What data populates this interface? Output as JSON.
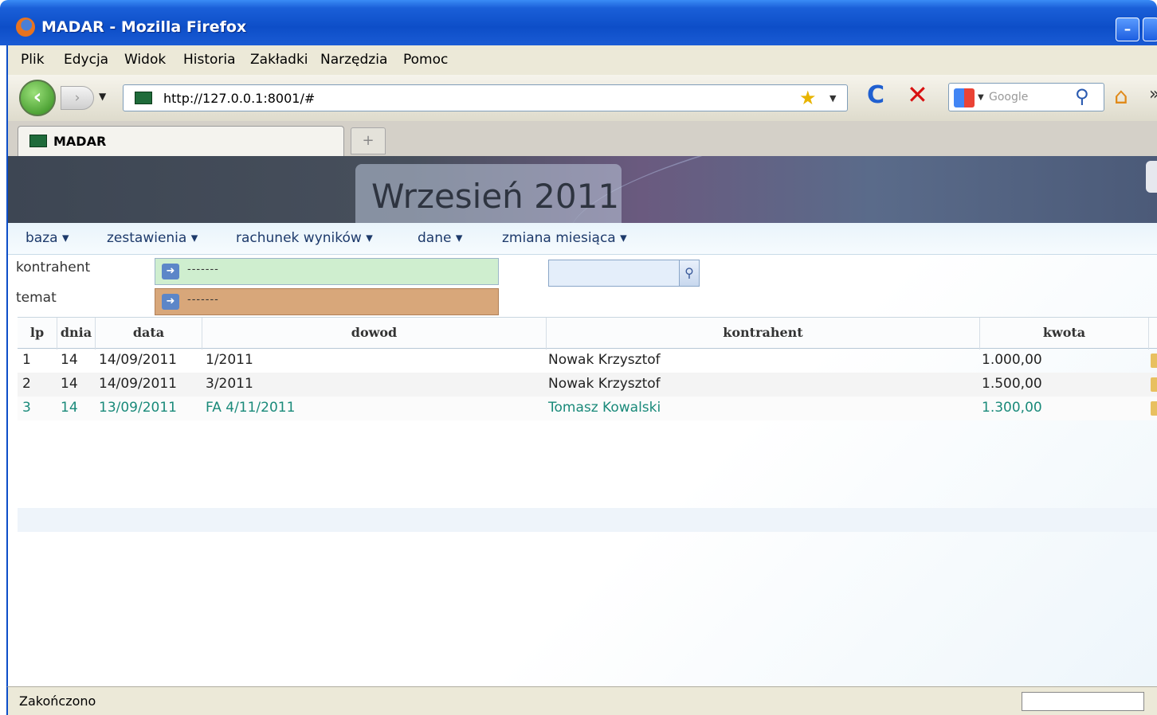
{
  "window": {
    "title": "MADAR - Mozilla Firefox"
  },
  "menubar": {
    "items": [
      "Plik",
      "Edycja",
      "Widok",
      "Historia",
      "Zakładki",
      "Narzędzia",
      "Pomoc"
    ]
  },
  "navbar": {
    "url": "http://127.0.0.1:8001/#",
    "search_placeholder": "Google"
  },
  "tab": {
    "label": "MADAR",
    "new_tab": "+"
  },
  "app": {
    "month_title": "Wrzesień 2011",
    "menu": [
      "baza ▾",
      "zestawienia ▾",
      "rachunek wyników ▾",
      "dane ▾",
      "zmiana miesiąca ▾"
    ],
    "filters": {
      "kontrahent_label": "kontrahent",
      "temat_label": "temat",
      "kontrahent_value": "-------",
      "temat_value": "-------",
      "search_value": ""
    },
    "grid": {
      "headers": [
        "lp",
        "dnia",
        "data",
        "dowod",
        "kontrahent",
        "kwota"
      ],
      "rows": [
        {
          "lp": "1",
          "dnia": "14",
          "data": "14/09/2011",
          "dowod": "1/2011",
          "kontrahent": "Nowak Krzysztof",
          "kwota": "1.000,00"
        },
        {
          "lp": "2",
          "dnia": "14",
          "data": "14/09/2011",
          "dowod": "3/2011",
          "kontrahent": "Nowak Krzysztof",
          "kwota": "1.500,00"
        },
        {
          "lp": "3",
          "dnia": "14",
          "data": "13/09/2011",
          "dowod": "FA 4/11/2011",
          "kontrahent": "Tomasz Kowalski",
          "kwota": "1.300,00"
        }
      ]
    }
  },
  "statusbar": {
    "text": "Zakończono"
  },
  "colors": {
    "titlebar": "#0d4ec8",
    "selected_row_text": "#1a8a7a",
    "kontrahent_combo": "#cfeecf",
    "temat_combo": "#d8a77a"
  }
}
